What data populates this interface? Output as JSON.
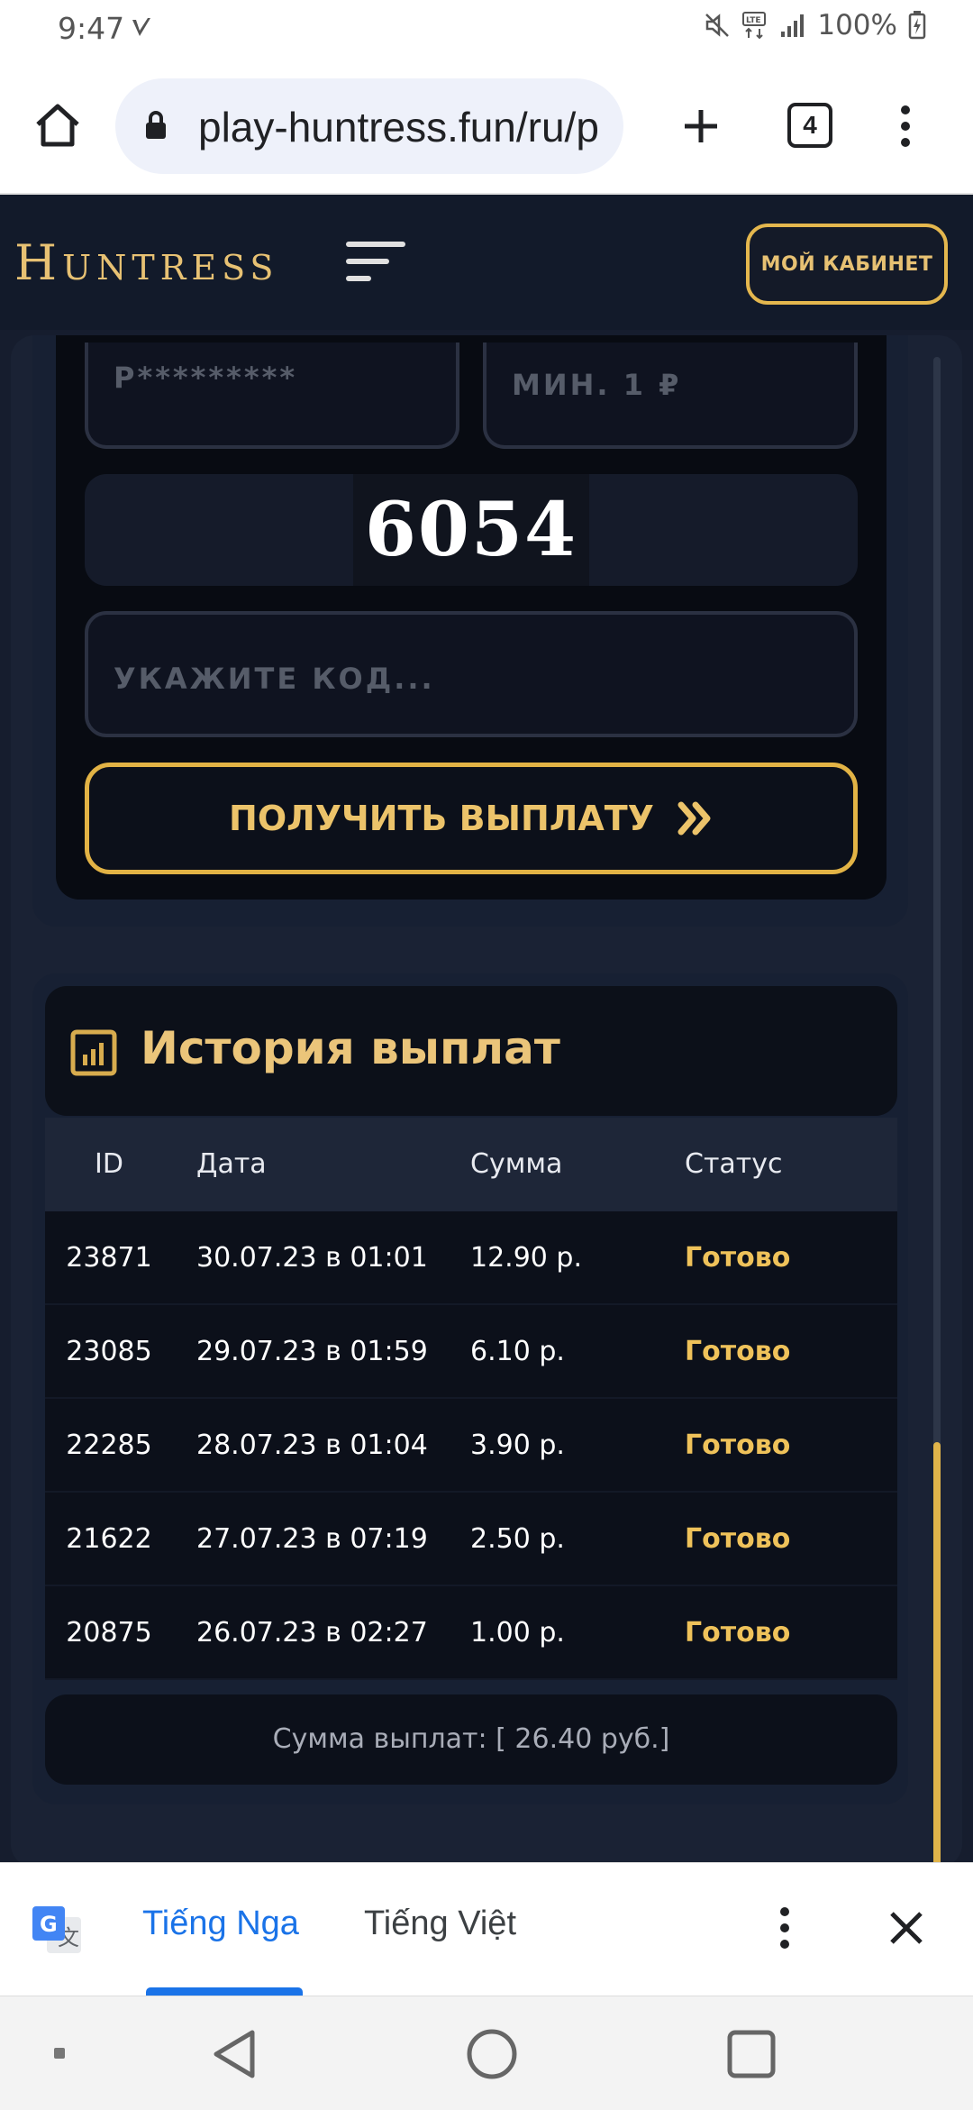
{
  "status_bar": {
    "time": "9:47",
    "battery": "100%"
  },
  "browser": {
    "url": "play-huntress.fun/ru/p",
    "tab_count": "4"
  },
  "site": {
    "logo": "Huntress",
    "cabinet_button": "МОЙ КАБИНЕТ"
  },
  "form": {
    "wallet_placeholder": "P*********",
    "amount_placeholder": "МИН. 1 ₽",
    "captcha_code": "6054",
    "code_placeholder": "УКАЖИТЕ КОД...",
    "submit_label": "ПОЛУЧИТЬ ВЫПЛАТУ"
  },
  "history": {
    "title": "История выплат",
    "columns": [
      "ID",
      "Дата",
      "Сумма",
      "Статус"
    ],
    "rows": [
      {
        "id": "23871",
        "date": "30.07.23 в 01:01",
        "sum": "12.90 р.",
        "status": "Готово"
      },
      {
        "id": "23085",
        "date": "29.07.23 в 01:59",
        "sum": "6.10 р.",
        "status": "Готово"
      },
      {
        "id": "22285",
        "date": "28.07.23 в 01:04",
        "sum": "3.90 р.",
        "status": "Готово"
      },
      {
        "id": "21622",
        "date": "27.07.23 в 07:19",
        "sum": "2.50 р.",
        "status": "Готово"
      },
      {
        "id": "20875",
        "date": "26.07.23 в 02:27",
        "sum": "1.00 р.",
        "status": "Готово"
      }
    ],
    "total": "Сумма выплат: [ 26.40 руб.]"
  },
  "translate": {
    "source_lang": "Tiếng Nga",
    "target_lang": "Tiếng Việt"
  },
  "colors": {
    "gold": "#e4b74e",
    "bg": "#161d2e",
    "link_blue": "#1a73e8"
  }
}
